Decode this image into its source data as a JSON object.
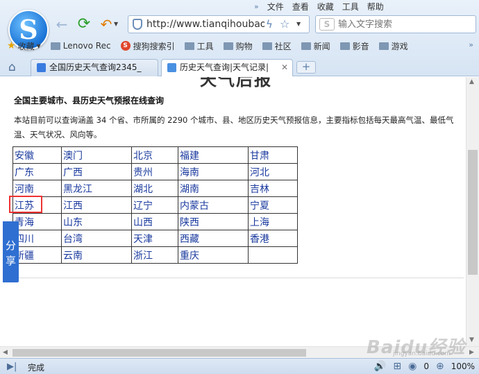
{
  "menu": [
    "文件",
    "查看",
    "收藏",
    "工具",
    "帮助"
  ],
  "address": {
    "url": "http://www.tianqihoubao"
  },
  "search": {
    "placeholder": "输入文字搜索"
  },
  "bookmarks": {
    "favorites": "收藏",
    "items": [
      "Lenovo Rec",
      "搜狗搜索引",
      "工具",
      "购物",
      "社区",
      "新闻",
      "影音",
      "游戏"
    ]
  },
  "tabs": [
    {
      "title": "全国历史天气查询2345_"
    },
    {
      "title": "历史天气查询|天气记录|"
    }
  ],
  "page": {
    "banner": "天气后报",
    "section_title": "全国主要城市、县历史天气预报在线查询",
    "intro": "本站目前可以查询涵盖 34 个省、市所属的 2290 个城市、县、地区历史天气预报信息，主要指标包括每天最高气温、最低气温、天气状况、风向等。",
    "provinces": [
      [
        "安徽",
        "澳门",
        "北京",
        "福建",
        "甘肃"
      ],
      [
        "广东",
        "广西",
        "贵州",
        "海南",
        "河北"
      ],
      [
        "河南",
        "黑龙江",
        "湖北",
        "湖南",
        "吉林"
      ],
      [
        "江苏",
        "江西",
        "辽宁",
        "内蒙古",
        "宁夏"
      ],
      [
        "青海",
        "山东",
        "山西",
        "陕西",
        "上海"
      ],
      [
        "四川",
        "台湾",
        "天津",
        "西藏",
        "香港"
      ],
      [
        "新疆",
        "云南",
        "浙江",
        "重庆",
        ""
      ]
    ],
    "highlighted": "江苏",
    "share": "分享"
  },
  "status": {
    "text": "完成",
    "count": "0",
    "zoom": "100%"
  },
  "watermark": {
    "main": "Baidu经验",
    "sub": "jingyan.baidu.com"
  },
  "colors": {
    "link": "#1a3a9e",
    "highlight": "#e33333",
    "share": "#2f6fd1"
  }
}
